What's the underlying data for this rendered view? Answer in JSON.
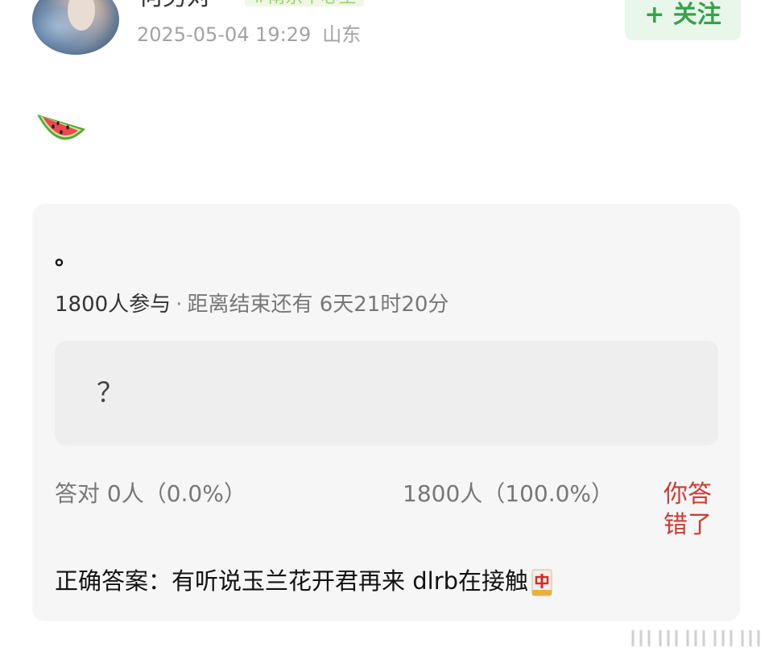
{
  "header": {
    "username": "何男对",
    "tag": "#南京中心生",
    "timestamp": "2025-05-04 19:29",
    "location": "山东",
    "follow_label": "+ 关注"
  },
  "post": {
    "emoji_icon": "watermelon-icon"
  },
  "quiz": {
    "title": "。",
    "participants": "1800人参与",
    "separator": "·",
    "deadline": "距离结束还有 6天21时20分",
    "option_text": "？",
    "correct_count": "答对  0人（0.0%）",
    "wrong_count": "1800人（100.0%）",
    "result_status": "你答错了",
    "answer_label": "正确答案：",
    "answer_text": "有听说玉兰花开君再来 dlrb在接触",
    "answer_icon": "mahjong-red-dragon-icon"
  },
  "colors": {
    "accent_green": "#35a34a",
    "wrong_red": "#cc3b33",
    "card_bg": "#f6f6f6"
  }
}
